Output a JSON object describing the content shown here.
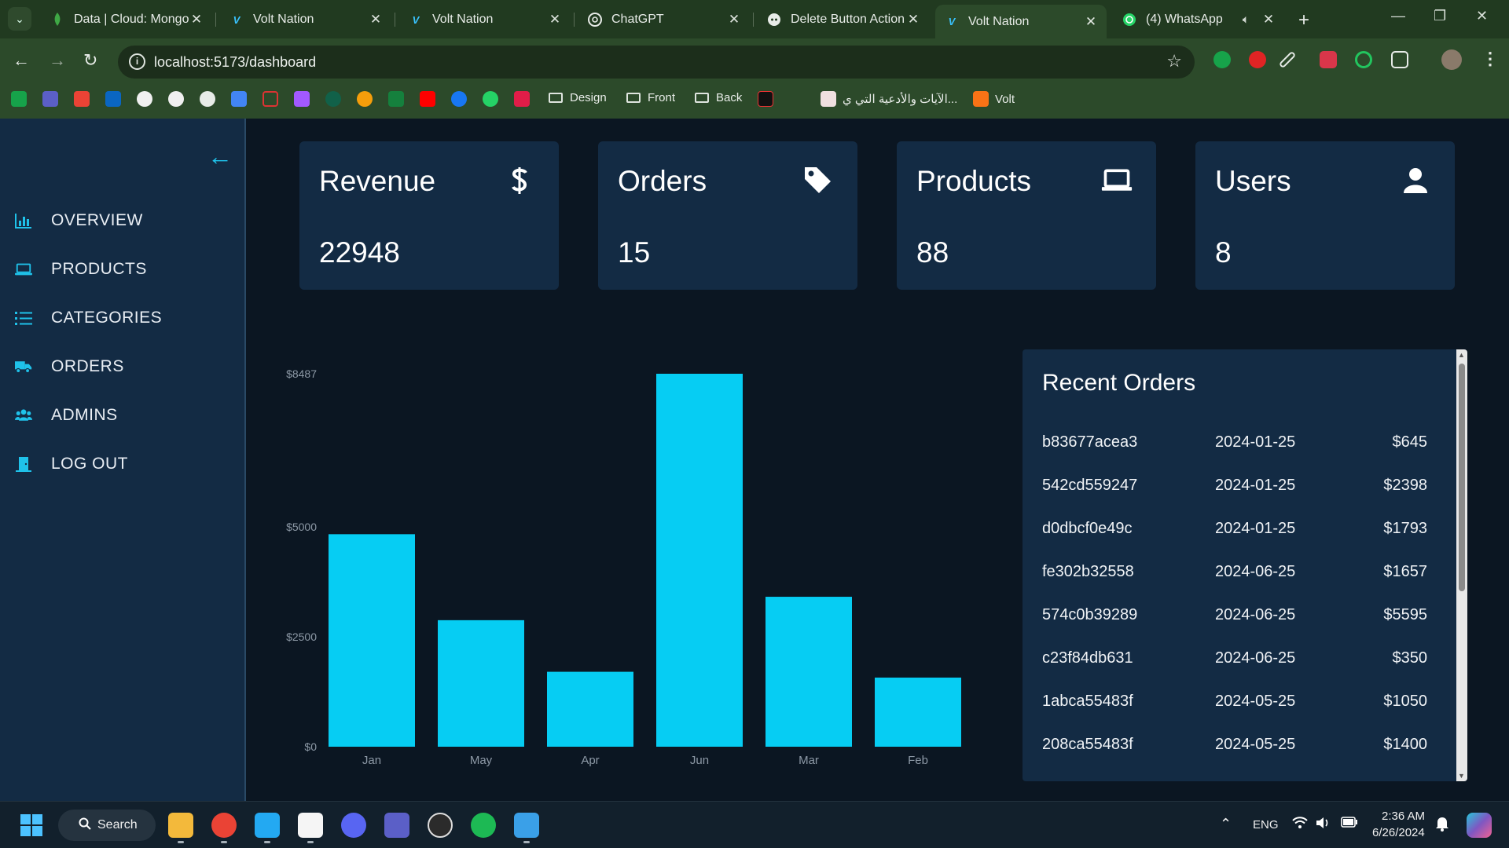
{
  "browser": {
    "tabs": [
      {
        "title": "Data | Cloud: MongoDB",
        "favicon": "mongodb-leaf-icon",
        "active": false
      },
      {
        "title": "Volt Nation",
        "favicon": "volt-icon",
        "active": false
      },
      {
        "title": "Volt Nation",
        "favicon": "volt-icon",
        "active": false
      },
      {
        "title": "ChatGPT",
        "favicon": "chatgpt-icon",
        "active": false
      },
      {
        "title": "Delete Button Action",
        "favicon": "discord-style-icon",
        "active": false
      },
      {
        "title": "Volt Nation",
        "favicon": "volt-icon",
        "active": true
      },
      {
        "title": "(4) WhatsApp",
        "favicon": "whatsapp-icon",
        "active": false
      }
    ],
    "url": "localhost:5173/dashboard",
    "bookmark_folders": [
      "Design",
      "Front",
      "Back"
    ],
    "bookmark_links": [
      "الآيات والأدعية التي ي...",
      "Volt"
    ]
  },
  "sidebar": {
    "items": [
      {
        "label": "OVERVIEW",
        "icon": "bar-chart-icon"
      },
      {
        "label": "PRODUCTS",
        "icon": "laptop-icon"
      },
      {
        "label": "CATEGORIES",
        "icon": "list-icon"
      },
      {
        "label": "ORDERS",
        "icon": "truck-icon"
      },
      {
        "label": "ADMINS",
        "icon": "users-icon"
      },
      {
        "label": "LOG OUT",
        "icon": "door-exit-icon"
      }
    ]
  },
  "cards": [
    {
      "title": "Revenue",
      "value": "22948",
      "icon": "dollar-icon"
    },
    {
      "title": "Orders",
      "value": "15",
      "icon": "tag-icon"
    },
    {
      "title": "Products",
      "value": "88",
      "icon": "laptop-icon"
    },
    {
      "title": "Users",
      "value": "8",
      "icon": "user-icon"
    }
  ],
  "chart_data": {
    "type": "bar",
    "categories": [
      "Jan",
      "May",
      "Apr",
      "Jun",
      "Mar",
      "Feb"
    ],
    "values": [
      4836,
      2879,
      1705,
      8487,
      3412,
      1573
    ],
    "y_ticks": [
      {
        "value": 0,
        "label": "$0"
      },
      {
        "value": 2500,
        "label": "$2500"
      },
      {
        "value": 5000,
        "label": "$5000"
      },
      {
        "value": 8487,
        "label": "$8487"
      }
    ],
    "ylim": [
      0,
      8487
    ],
    "bar_color": "#06cdf3",
    "grid": false,
    "title": "",
    "xlabel": "",
    "ylabel": ""
  },
  "recent_orders": {
    "title": "Recent Orders",
    "rows": [
      {
        "id": "b83677acea3",
        "date": "2024-01-25",
        "price": "$645"
      },
      {
        "id": "542cd559247",
        "date": "2024-01-25",
        "price": "$2398"
      },
      {
        "id": "d0dbcf0e49c",
        "date": "2024-01-25",
        "price": "$1793"
      },
      {
        "id": "fe302b32558",
        "date": "2024-06-25",
        "price": "$1657"
      },
      {
        "id": "574c0b39289",
        "date": "2024-06-25",
        "price": "$5595"
      },
      {
        "id": "c23f84db631",
        "date": "2024-06-25",
        "price": "$350"
      },
      {
        "id": "1abca55483f",
        "date": "2024-05-25",
        "price": "$1050"
      },
      {
        "id": "208ca55483f",
        "date": "2024-05-25",
        "price": "$1400"
      }
    ]
  },
  "taskbar": {
    "search_label": "Search",
    "language": "ENG",
    "time": "2:36 AM",
    "date": "6/26/2024"
  },
  "colors": {
    "accent": "#1fc2ea",
    "bar": "#06cdf3",
    "card_bg": "#132b44",
    "page_bg": "#0b1622",
    "chrome_bg": "#2c4a2a"
  }
}
